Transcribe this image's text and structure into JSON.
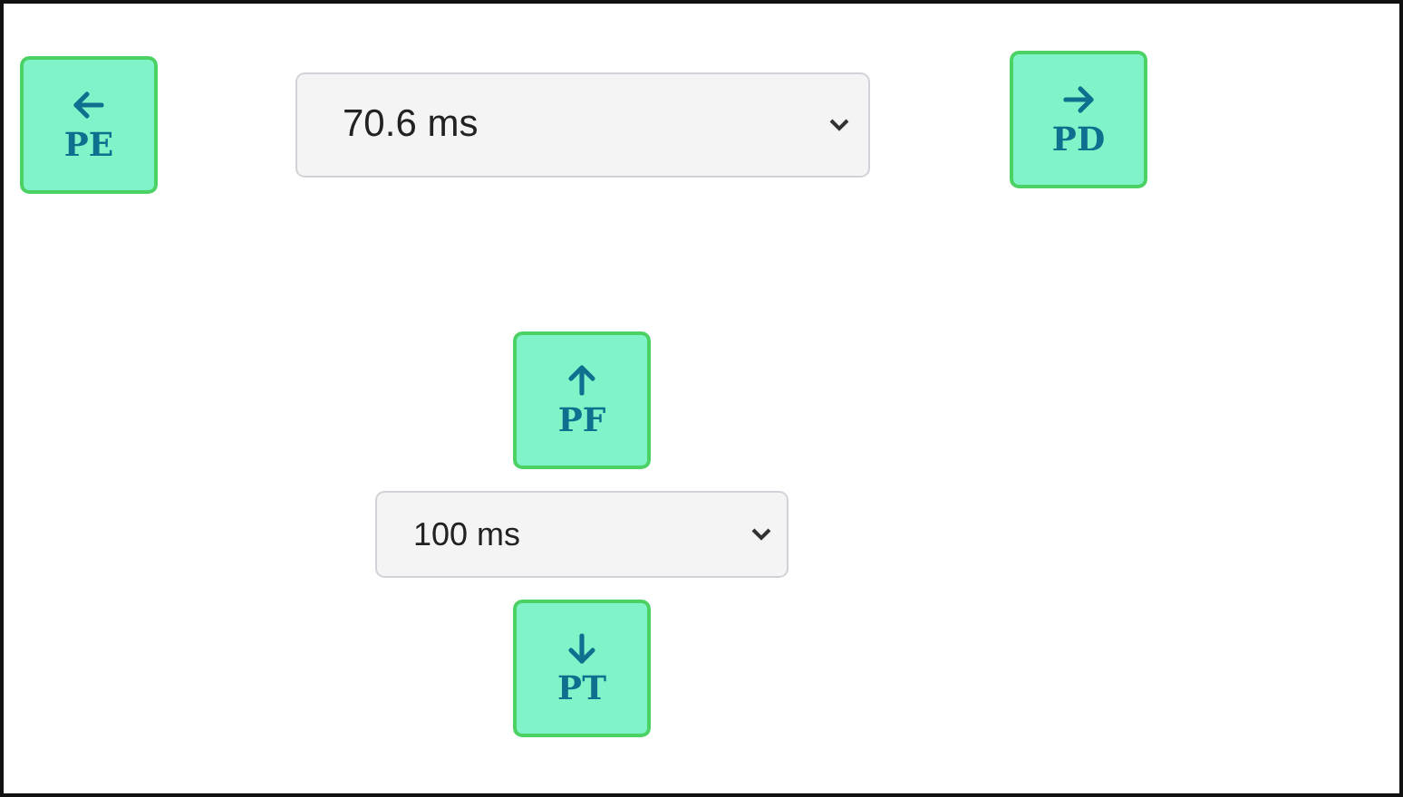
{
  "top_row": {
    "left_button": {
      "label": "PE",
      "kind": "left"
    },
    "interval_select": {
      "value": "70.6 ms"
    },
    "right_button": {
      "label": "PD",
      "kind": "right"
    }
  },
  "bottom_column": {
    "up_button": {
      "label": "PF",
      "kind": "up"
    },
    "step_select": {
      "value": "100 ms"
    },
    "down_button": {
      "label": "PT",
      "kind": "down"
    }
  }
}
